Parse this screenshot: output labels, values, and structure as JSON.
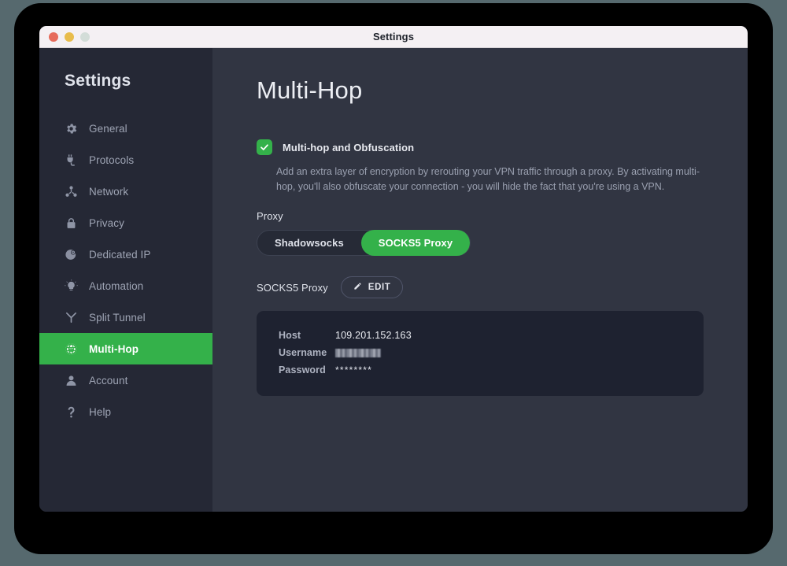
{
  "window": {
    "title": "Settings",
    "traffic_lights": [
      "close",
      "minimize",
      "zoom"
    ]
  },
  "sidebar": {
    "title": "Settings",
    "items": [
      {
        "label": "General",
        "icon": "gear-icon",
        "active": false
      },
      {
        "label": "Protocols",
        "icon": "plug-icon",
        "active": false
      },
      {
        "label": "Network",
        "icon": "network-icon",
        "active": false
      },
      {
        "label": "Privacy",
        "icon": "lock-icon",
        "active": false
      },
      {
        "label": "Dedicated IP",
        "icon": "pin-globe-icon",
        "active": false
      },
      {
        "label": "Automation",
        "icon": "lightbulb-icon",
        "active": false
      },
      {
        "label": "Split Tunnel",
        "icon": "split-tunnel-icon",
        "active": false
      },
      {
        "label": "Multi-Hop",
        "icon": "globe-arrow-icon",
        "active": true
      },
      {
        "label": "Account",
        "icon": "user-icon",
        "active": false
      },
      {
        "label": "Help",
        "icon": "question-icon",
        "active": false
      }
    ]
  },
  "main": {
    "page_title": "Multi-Hop",
    "toggle": {
      "label": "Multi-hop and Obfuscation",
      "checked": true,
      "description": "Add an extra layer of encryption by rerouting your VPN traffic through a proxy. By activating multi-hop, you'll also obfuscate your connection - you will hide the fact that you're using a VPN."
    },
    "proxy": {
      "section_label": "Proxy",
      "options": [
        {
          "label": "Shadowsocks",
          "selected": false
        },
        {
          "label": "SOCKS5 Proxy",
          "selected": true
        }
      ],
      "selected_name": "SOCKS5 Proxy",
      "edit_button": "EDIT",
      "credentials": [
        {
          "key": "Host",
          "value": "109.201.152.163",
          "type": "text"
        },
        {
          "key": "Username",
          "value": "",
          "type": "redacted"
        },
        {
          "key": "Password",
          "value": "********",
          "type": "password"
        }
      ]
    }
  },
  "colors": {
    "accent_green": "#34b14a",
    "sidebar_bg": "#252835",
    "content_bg": "#313542",
    "card_bg": "#1e2230",
    "titlebar_bg": "#f4f0f3",
    "outer_bg": "#56696e"
  }
}
